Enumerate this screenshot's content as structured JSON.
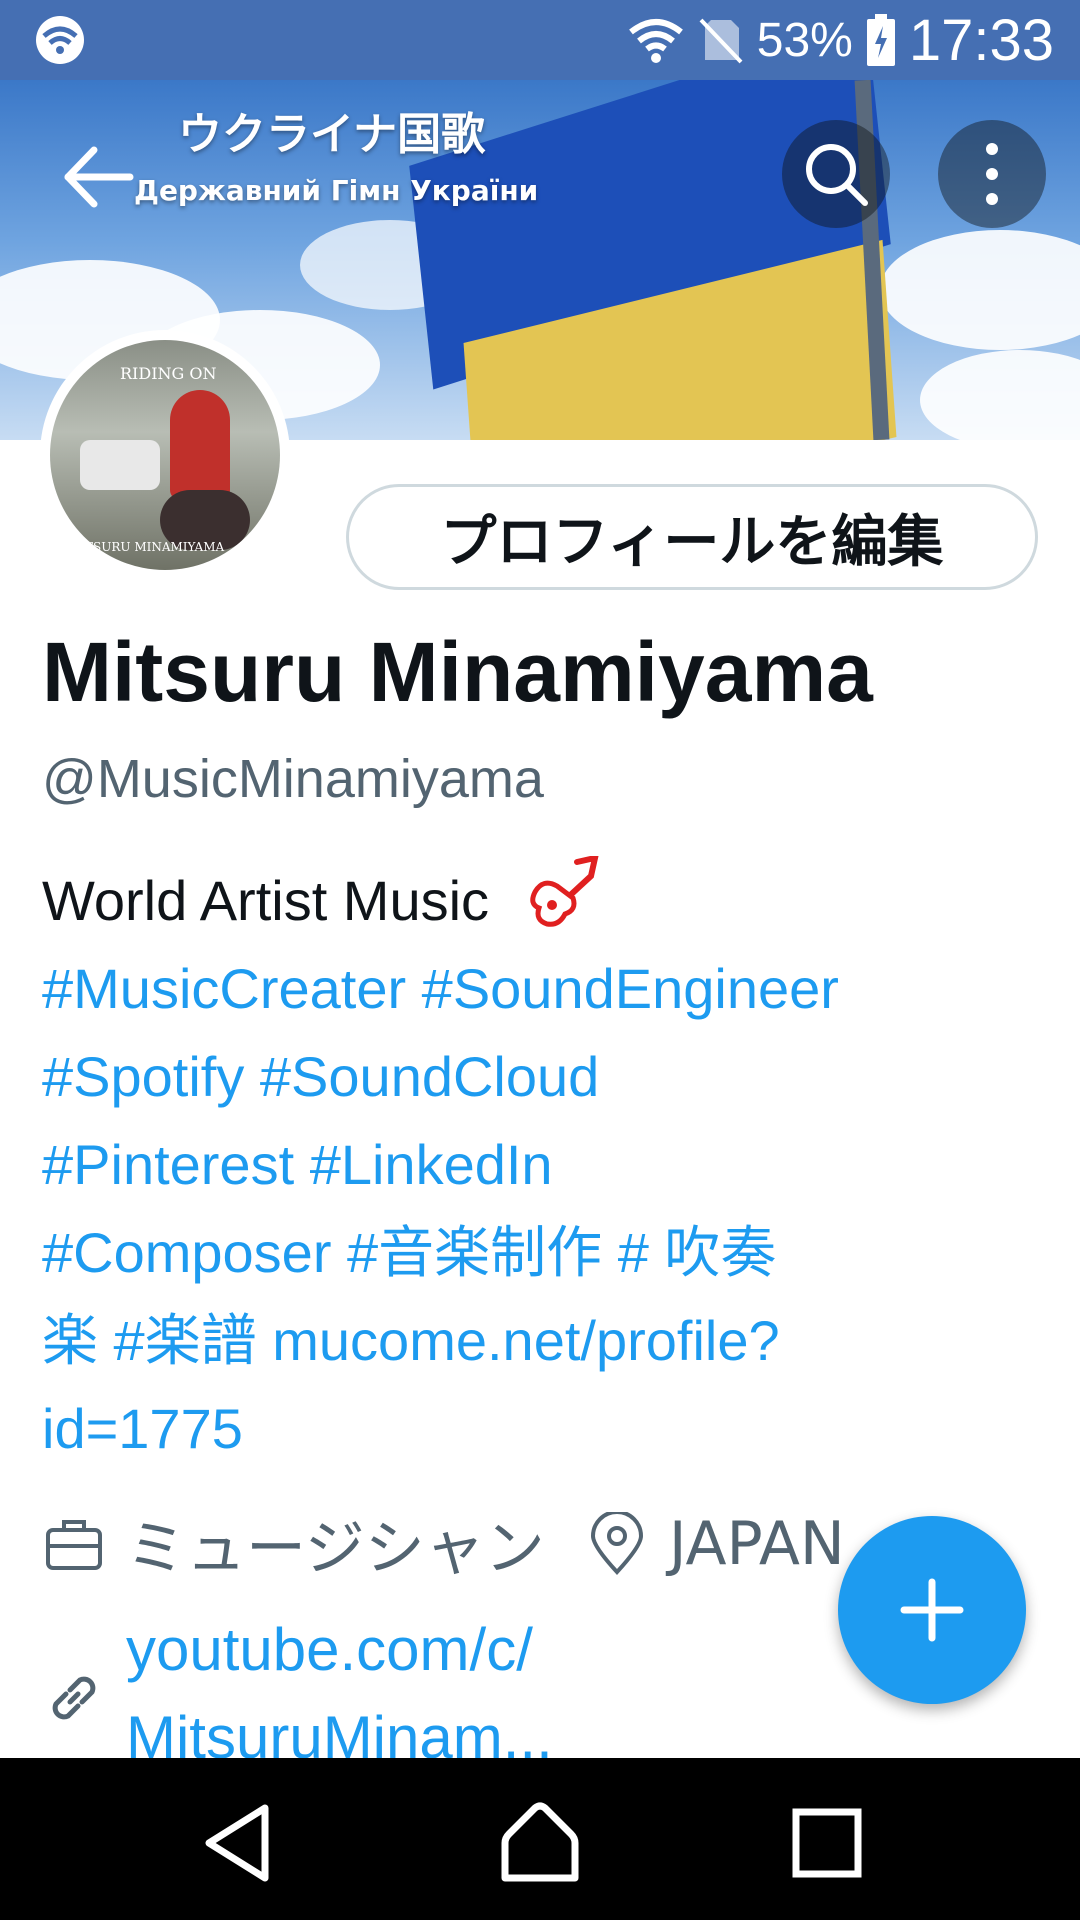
{
  "status_bar": {
    "battery_percent": "53%",
    "time": "17:33"
  },
  "header": {
    "banner_title": "ウクライナ国歌",
    "banner_subtitle": "Державний Гімн України",
    "avatar_text_top": "RIDING ON",
    "avatar_text_bottom": "MITSURU MINAMIYAMA",
    "edit_profile_label": "プロフィールを編集"
  },
  "profile": {
    "name": "Mitsuru Minamiyama",
    "handle": "@MusicMinamiyama",
    "bio": {
      "line1": "World Artist Music",
      "line2": "#MusicCreater #SoundEngineer",
      "line3": "#Spotify  #SoundCloud",
      "line4": "#Pinterest  #LinkedIn",
      "line5": "#Composer #音楽制作 # 吹奏",
      "line6": "楽 #楽譜 mucome.net/profile?",
      "line7": "id=1775"
    },
    "job": "ミュージシャン",
    "location": "JAPAN",
    "link_line1": "youtube.com/c/",
    "link_line2": "MitsuruMinam..."
  },
  "colors": {
    "accent": "#1d9bf0",
    "status_bar": "#456fb3",
    "secondary_text": "#536471"
  }
}
